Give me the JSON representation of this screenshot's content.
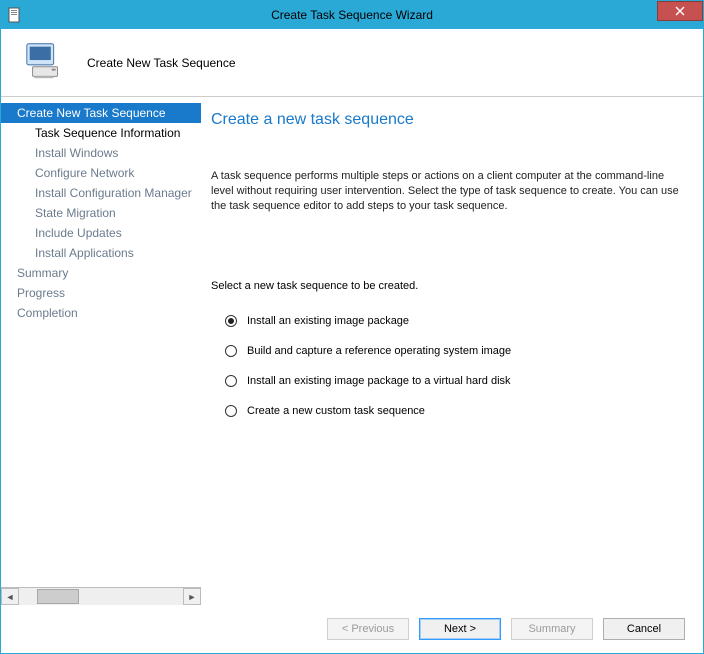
{
  "window": {
    "title": "Create Task Sequence Wizard"
  },
  "header": {
    "subtitle": "Create New Task Sequence"
  },
  "nav": {
    "items": [
      {
        "label": "Create New Task Sequence",
        "level": 0,
        "state": "selected"
      },
      {
        "label": "Task Sequence Information",
        "level": 1,
        "state": "current"
      },
      {
        "label": "Install Windows",
        "level": 1,
        "state": ""
      },
      {
        "label": "Configure Network",
        "level": 1,
        "state": ""
      },
      {
        "label": "Install Configuration Manager",
        "level": 1,
        "state": ""
      },
      {
        "label": "State Migration",
        "level": 1,
        "state": ""
      },
      {
        "label": "Include Updates",
        "level": 1,
        "state": ""
      },
      {
        "label": "Install Applications",
        "level": 1,
        "state": ""
      },
      {
        "label": "Summary",
        "level": 0,
        "state": ""
      },
      {
        "label": "Progress",
        "level": 0,
        "state": ""
      },
      {
        "label": "Completion",
        "level": 0,
        "state": ""
      }
    ]
  },
  "main": {
    "heading": "Create a new task sequence",
    "description": "A task sequence performs multiple steps or actions on a client computer at the command-line level without requiring user intervention. Select the type of task sequence to create. You can use the task sequence editor to add steps to your task sequence.",
    "select_label": "Select a new task sequence to be created.",
    "options": [
      {
        "label": "Install an existing image package",
        "checked": true
      },
      {
        "label": "Build and capture a reference operating system image",
        "checked": false
      },
      {
        "label": "Install an existing image package to a virtual hard disk",
        "checked": false
      },
      {
        "label": "Create a new custom task sequence",
        "checked": false
      }
    ]
  },
  "footer": {
    "previous": "< Previous",
    "next": "Next >",
    "summary": "Summary",
    "cancel": "Cancel"
  }
}
